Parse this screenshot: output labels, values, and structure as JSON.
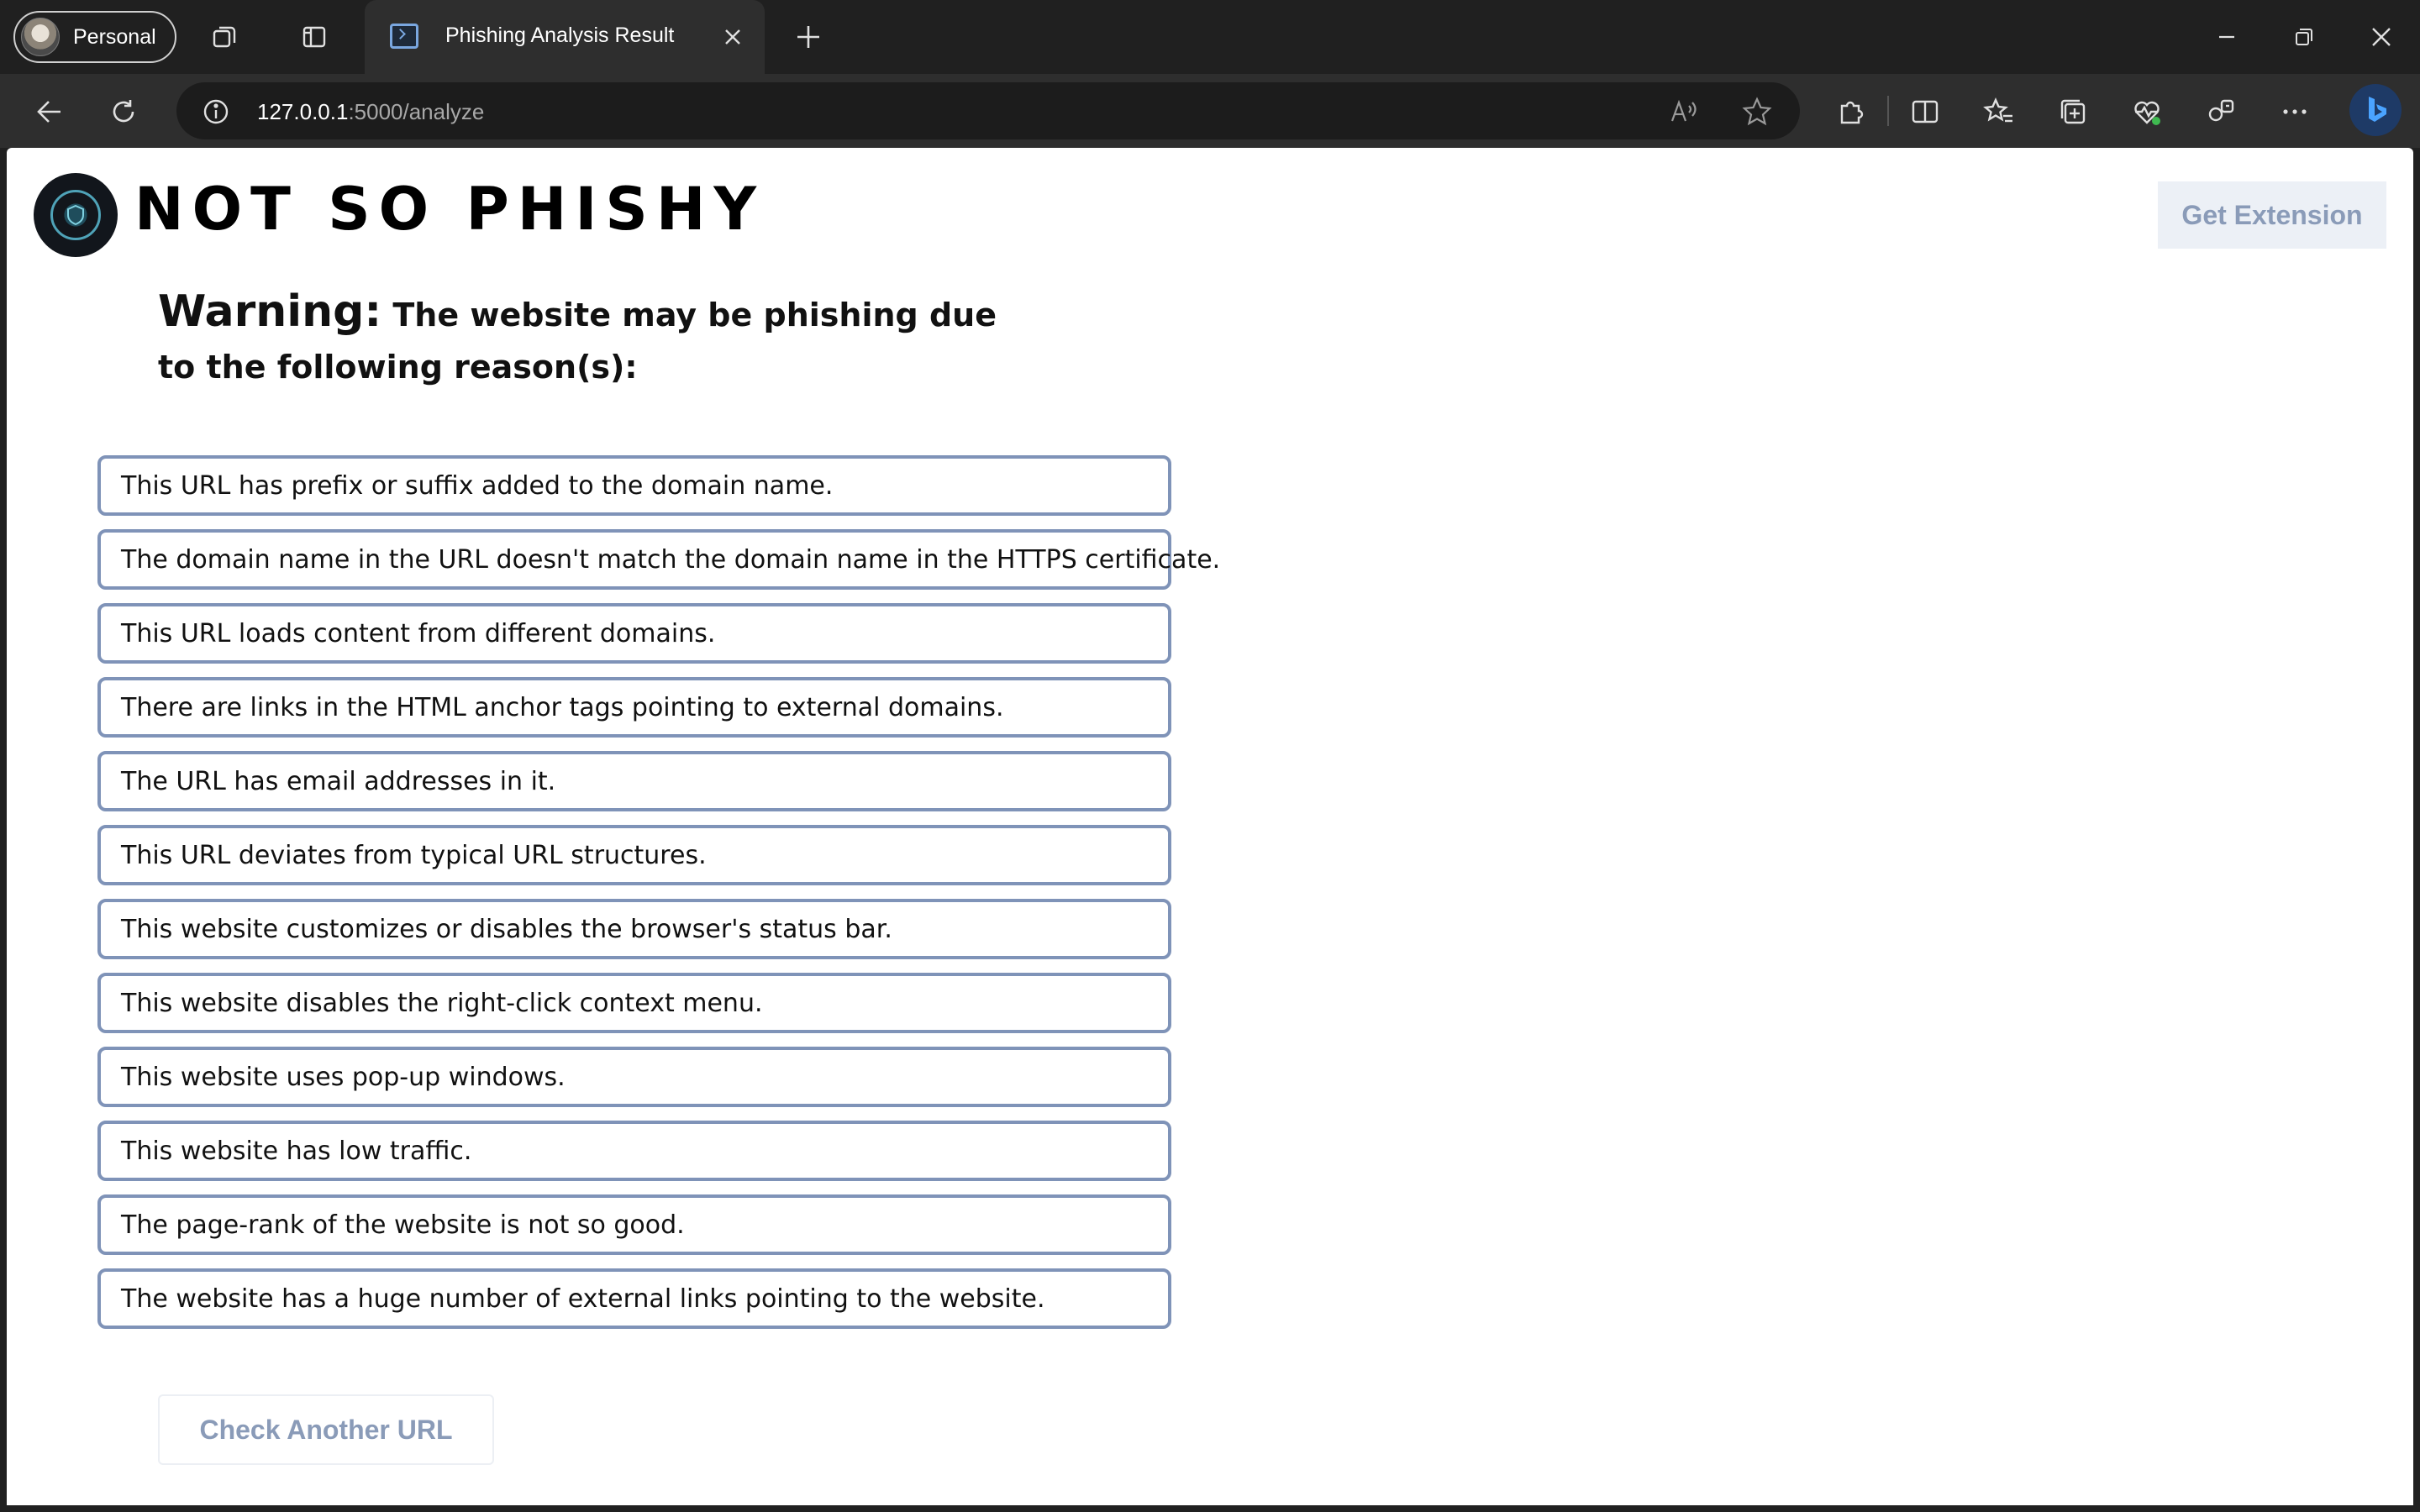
{
  "browser": {
    "profile_label": "Personal",
    "tab_title": "Phishing Analysis Result",
    "url_host": "127.0.0.1",
    "url_path": ":5000/analyze",
    "colors": {
      "chrome_bg": "#202020",
      "toolbar_bg": "#2e2e2e",
      "accent": "#7aa7e0"
    }
  },
  "page": {
    "brand_title": "NOT SO PHISHY",
    "extension_button": "Get Extension",
    "warning_label": "Warning:",
    "warning_text": "The website may be phishing due to the following reason(s):",
    "reasons": [
      "This URL has prefix or suffix added to the domain name.",
      "The domain name in the URL doesn't match the domain name in the HTTPS certificate.",
      "This URL loads content from different domains.",
      "There are links in the HTML anchor tags pointing to external domains.",
      "The URL has email addresses in it.",
      "This URL deviates from typical URL structures.",
      "This website customizes or disables the browser's status bar.",
      "This website disables the right-click context menu.",
      "This website uses pop-up windows.",
      "This website has low traffic.",
      "The page-rank of the website is not so good.",
      "The website has a huge number of external links pointing to the website."
    ],
    "check_button": "Check Another URL",
    "colors": {
      "reason_border": "#7f93b8",
      "button_text": "#8a9bb8"
    }
  }
}
